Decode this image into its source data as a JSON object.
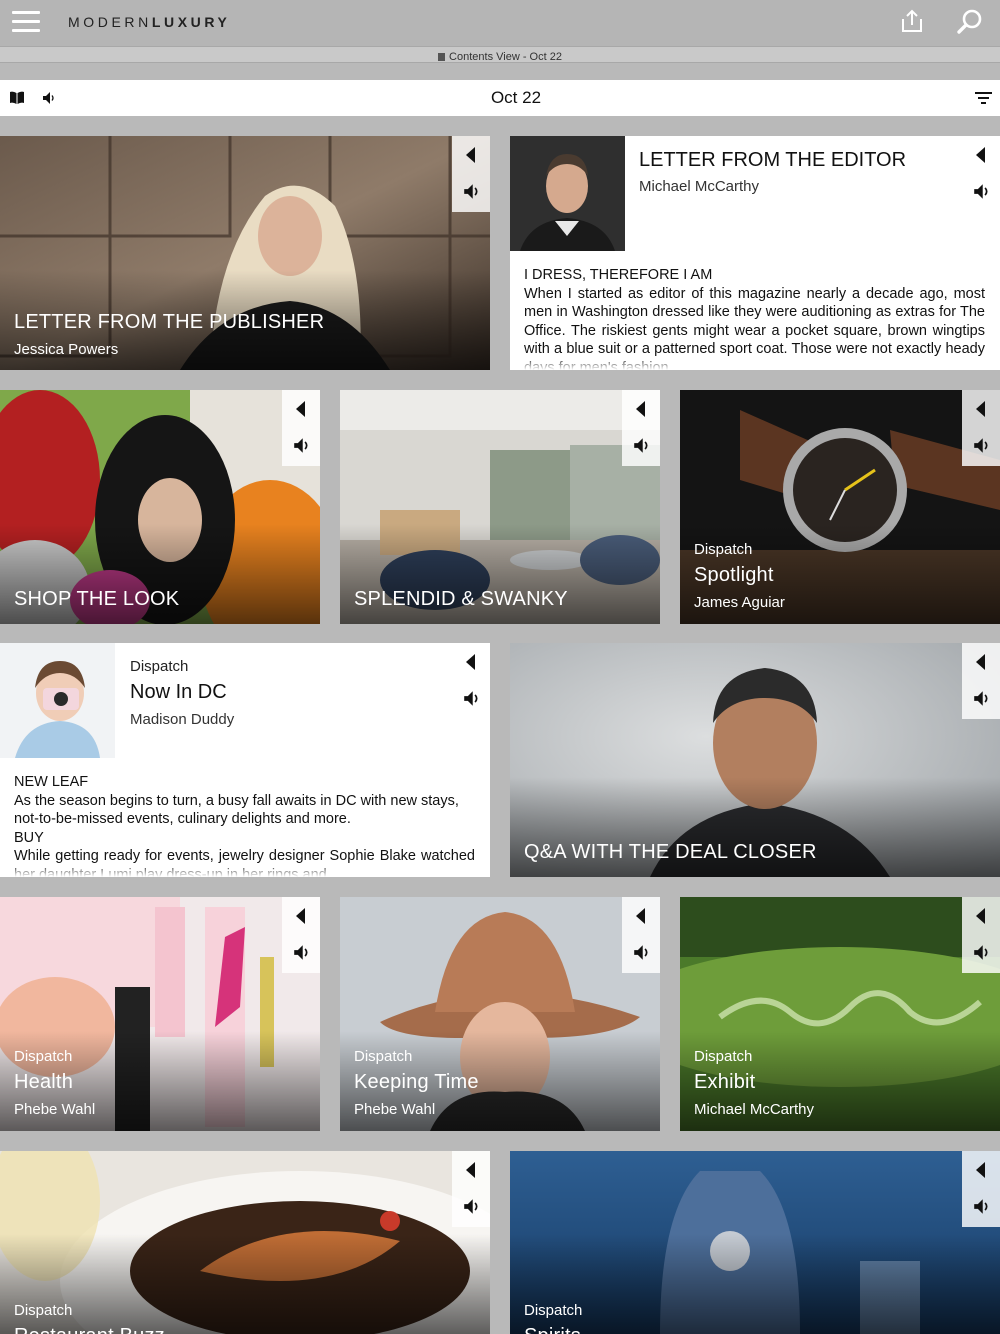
{
  "app": {
    "brand_light": "MODERN",
    "brand_bold": "LUXURY",
    "subtitle": "Contents View - Oct 22",
    "issue": "Oct 22"
  },
  "icons": {
    "menu": "hamburger-icon",
    "share": "share-icon",
    "search": "search-icon",
    "book": "book-icon",
    "audio": "speaker-icon",
    "filter": "filter-icon",
    "back": "back-triangle-icon"
  },
  "articles": {
    "publisher": {
      "title": "LETTER FROM THE PUBLISHER",
      "author": "Jessica Powers"
    },
    "editor": {
      "title": "LETTER FROM THE EDITOR",
      "author": "Michael McCarthy",
      "excerpt_heading": "I DRESS, THEREFORE I AM",
      "excerpt": "When I started as editor of this magazine nearly a decade ago, most men in Washington dressed like they were auditioning as extras for The Office. The riskiest gents might wear a pocket square, brown wingtips with a blue suit or a patterned sport coat. Those were not exactly heady days for men's fashion."
    },
    "shop": {
      "title": "SHOP THE LOOK"
    },
    "splendid": {
      "title": "SPLENDID & SWANKY"
    },
    "spotlight": {
      "kicker": "Dispatch",
      "title": "Spotlight",
      "author": "James Aguiar"
    },
    "nowindc": {
      "kicker": "Dispatch",
      "title": "Now In DC",
      "author": "Madison Duddy",
      "h1": "NEW LEAF",
      "p1": "As the season begins to turn, a busy fall awaits in DC with new stays, not-to-be-missed events, culinary delights and more.",
      "h2": "BUY",
      "p2": "While getting ready for events, jewelry designer Sophie Blake watched her daughter Lumi play dress-up in her rings and"
    },
    "qa": {
      "title": "Q&A WITH THE DEAL CLOSER"
    },
    "health": {
      "kicker": "Dispatch",
      "title": "Health",
      "author": "Phebe Wahl"
    },
    "keeping": {
      "kicker": "Dispatch",
      "title": "Keeping Time",
      "author": "Phebe Wahl"
    },
    "exhibit": {
      "kicker": "Dispatch",
      "title": "Exhibit",
      "author": "Michael McCarthy"
    },
    "restaurant": {
      "kicker": "Dispatch",
      "title": "Restaurant Buzz"
    },
    "spirits": {
      "kicker": "Dispatch",
      "title": "Spirits"
    }
  }
}
